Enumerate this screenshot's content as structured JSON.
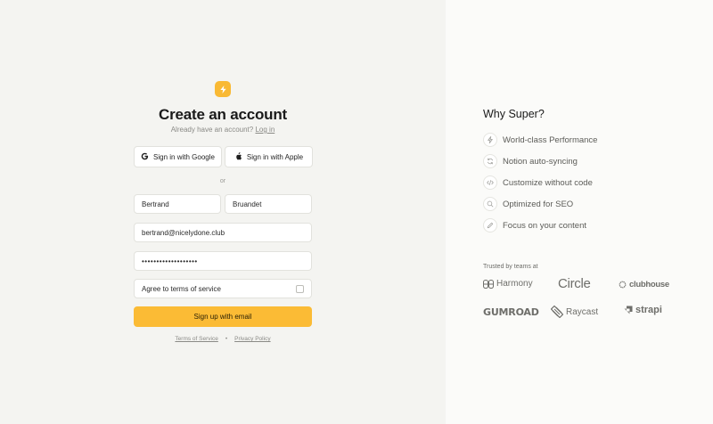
{
  "form": {
    "title": "Create an account",
    "subtitle_prefix": "Already have an account?",
    "login_link": "Log in",
    "google_label": "Sign in with Google",
    "apple_label": "Sign in with Apple",
    "or_label": "or",
    "first_name_value": "Bertrand",
    "last_name_value": "Bruandet",
    "email_value": "bertrand@nicelydone.club",
    "password_value": "•••••••••••••••••••",
    "terms_label": "Agree to terms of service",
    "terms_checked": false,
    "signup_label": "Sign up with email",
    "footer": {
      "terms_link": "Terms of Service",
      "separator": "•",
      "privacy_link": "Privacy Policy"
    }
  },
  "sidebar": {
    "heading": "Why Super?",
    "features": [
      {
        "label": "World-class Performance",
        "icon": "bolt-icon"
      },
      {
        "label": "Notion auto-syncing",
        "icon": "sync-icon"
      },
      {
        "label": "Customize without code",
        "icon": "code-icon"
      },
      {
        "label": "Optimized for SEO",
        "icon": "search-icon"
      },
      {
        "label": "Focus on your content",
        "icon": "pencil-icon"
      }
    ],
    "trusted_label": "Trusted by teams at",
    "brands": [
      "Harmony",
      "Circle",
      "clubhouse",
      "GUMROAD",
      "Raycast",
      "strapi"
    ]
  },
  "colors": {
    "accent": "#FBBB35",
    "left_bg": "#F4F4F1",
    "right_bg": "#FBFBF9"
  }
}
